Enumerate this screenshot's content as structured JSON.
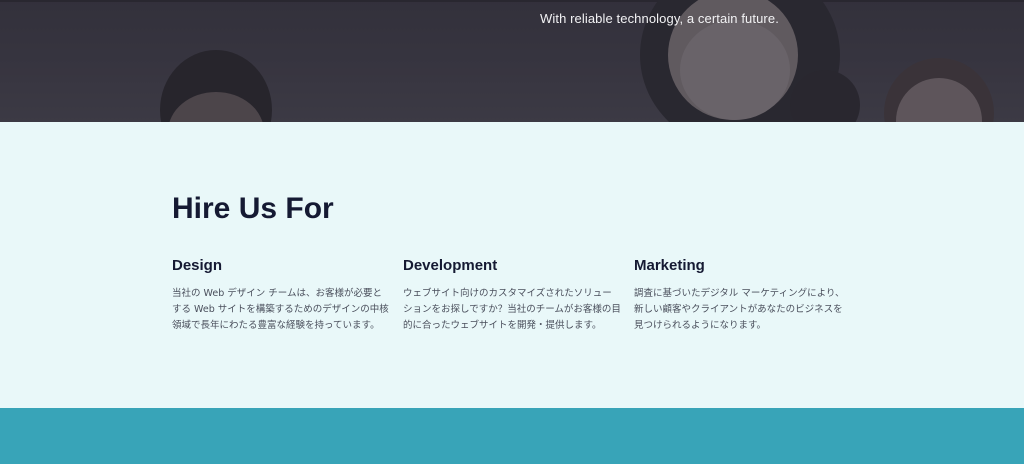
{
  "hero": {
    "tagline": "With reliable technology, a certain future."
  },
  "services": {
    "heading": "Hire Us For",
    "items": [
      {
        "title": "Design",
        "description": "当社の Web デザイン チームは、お客様が必要とする Web サイトを構築するためのデザインの中核領域で長年にわたる豊富な経験を持っています。"
      },
      {
        "title": "Development",
        "description": "ウェブサイト向けのカスタマイズされたソリューションをお探しですか？当社のチームがお客様の目的に合ったウェブサイトを開発・提供します。"
      },
      {
        "title": "Marketing",
        "description": "調査に基づいたデジタル マーケティングにより、新しい顧客やクライアントがあなたのビジネスを見つけられるようになります。"
      }
    ]
  },
  "colors": {
    "hero_bg": "#45434e",
    "section_bg": "#e9f8f9",
    "heading": "#151a33",
    "body_text": "#4a4f5c",
    "footer_band": "#38a4b8"
  }
}
